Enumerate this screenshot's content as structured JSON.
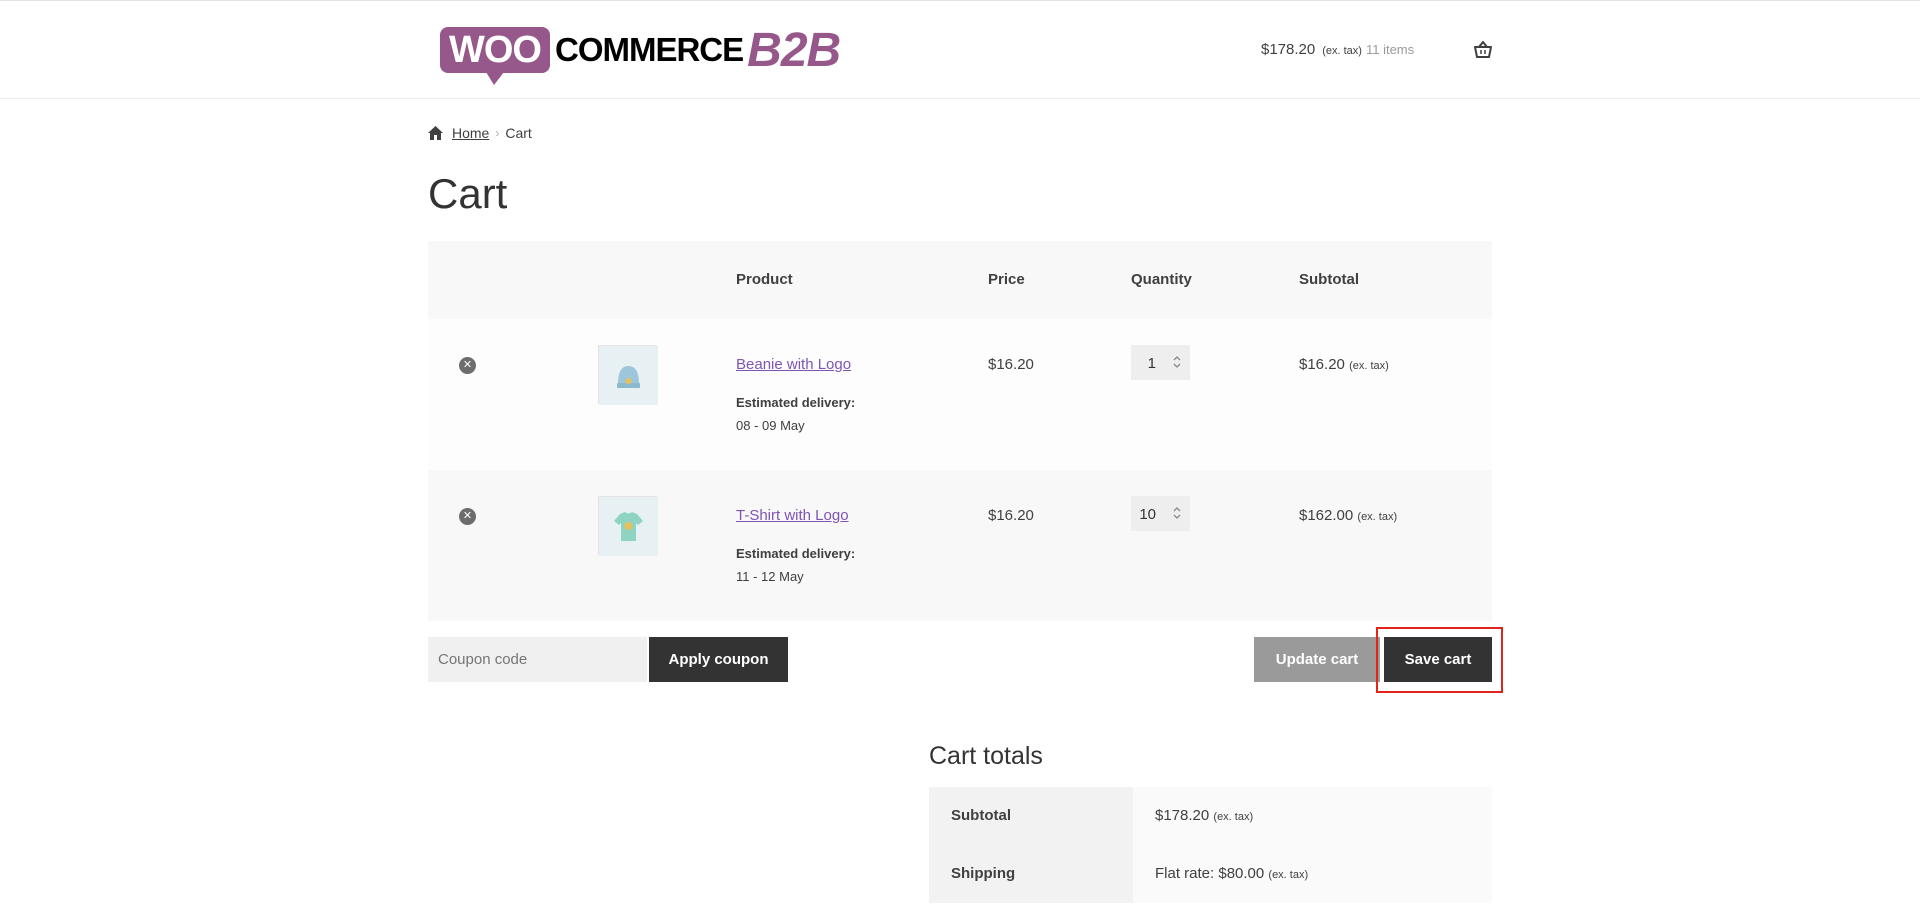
{
  "header": {
    "logo": {
      "woo": "WOO",
      "commerce": "COMMERCE",
      "b2b": "B2B"
    },
    "mini_cart": {
      "amount": "$178.20",
      "tax_note": "(ex. tax)",
      "items": "11 items",
      "icon": "basket-icon"
    }
  },
  "breadcrumb": {
    "home": "Home",
    "separator": "›",
    "current": "Cart",
    "icon": "home-icon"
  },
  "page": {
    "title": "Cart"
  },
  "cart": {
    "columns": {
      "product": "Product",
      "price": "Price",
      "quantity": "Quantity",
      "subtotal": "Subtotal"
    },
    "rows": [
      {
        "name": "Beanie with Logo",
        "estimated_label": "Estimated delivery:",
        "estimated_date": "08 - 09 May",
        "price": "$16.20",
        "quantity": "1",
        "subtotal": "$16.20",
        "subtotal_tax": "(ex. tax)"
      },
      {
        "name": "T-Shirt with Logo",
        "estimated_label": "Estimated delivery:",
        "estimated_date": "11 - 12 May",
        "price": "$16.20",
        "quantity": "10",
        "subtotal": "$162.00",
        "subtotal_tax": "(ex. tax)"
      }
    ],
    "remove_symbol": "✕"
  },
  "actions": {
    "coupon_placeholder": "Coupon code",
    "apply_coupon": "Apply coupon",
    "update_cart": "Update cart",
    "save_cart": "Save cart"
  },
  "totals": {
    "title": "Cart totals",
    "subtotal_label": "Subtotal",
    "subtotal_value": "$178.20",
    "subtotal_tax": "(ex. tax)",
    "shipping_label": "Shipping",
    "shipping_value": "Flat rate: $80.00",
    "shipping_tax": "(ex. tax)"
  },
  "colors": {
    "brand": "#96588a",
    "link": "#7f54b3",
    "dark_button": "#333333",
    "highlight": "#e3241b"
  }
}
